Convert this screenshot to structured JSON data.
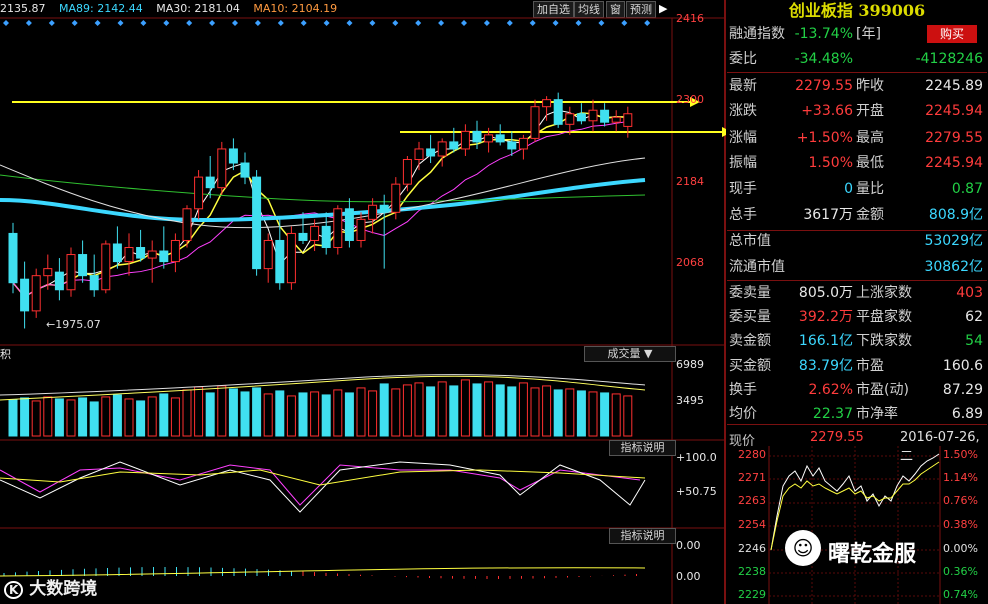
{
  "ma_bar": {
    "first": "2135.87",
    "ma89": "MA89: 2142.44",
    "ma30": "MA30: 2181.04",
    "ma10": "MA10: 2104.19"
  },
  "toolbar": {
    "add_watch": "加自选",
    "avg_line": "均线",
    "window": "窗",
    "forecast": "预测"
  },
  "chart_axes": {
    "main_ticks": [
      "2416",
      "2300",
      "2184",
      "2068"
    ],
    "low_annotation": "1975.07",
    "volume_ticks": [
      "6989",
      "3495"
    ],
    "volume_label": "成交量",
    "indicator_label": "指标说明",
    "indicator1_ticks": [
      "100.0",
      "50.75"
    ],
    "indicator2_ticks": [
      "0.00",
      "0.00"
    ],
    "left_stub": "积"
  },
  "chart_data": {
    "type": "candlestick",
    "title": "创业板指 399006",
    "y_ticks": [
      2416,
      2300,
      2184,
      2068
    ],
    "ylim": [
      1960,
      2420
    ],
    "low_marker": 1975.07,
    "horizontal_lines": [
      2300,
      2260
    ],
    "candles": [
      {
        "o": 2110,
        "h": 2125,
        "l": 2025,
        "c": 2040
      },
      {
        "o": 2045,
        "h": 2070,
        "l": 1975,
        "c": 2000
      },
      {
        "o": 2000,
        "h": 2060,
        "l": 1990,
        "c": 2050
      },
      {
        "o": 2050,
        "h": 2080,
        "l": 2030,
        "c": 2060
      },
      {
        "o": 2055,
        "h": 2075,
        "l": 2015,
        "c": 2030
      },
      {
        "o": 2030,
        "h": 2090,
        "l": 2020,
        "c": 2080
      },
      {
        "o": 2080,
        "h": 2100,
        "l": 2040,
        "c": 2050
      },
      {
        "o": 2050,
        "h": 2080,
        "l": 2020,
        "c": 2030
      },
      {
        "o": 2030,
        "h": 2100,
        "l": 2025,
        "c": 2095
      },
      {
        "o": 2095,
        "h": 2120,
        "l": 2060,
        "c": 2070
      },
      {
        "o": 2070,
        "h": 2110,
        "l": 2050,
        "c": 2090
      },
      {
        "o": 2090,
        "h": 2115,
        "l": 2070,
        "c": 2075
      },
      {
        "o": 2075,
        "h": 2100,
        "l": 2040,
        "c": 2085
      },
      {
        "o": 2085,
        "h": 2120,
        "l": 2060,
        "c": 2070
      },
      {
        "o": 2070,
        "h": 2110,
        "l": 2055,
        "c": 2100
      },
      {
        "o": 2100,
        "h": 2150,
        "l": 2090,
        "c": 2145
      },
      {
        "o": 2145,
        "h": 2200,
        "l": 2130,
        "c": 2190
      },
      {
        "o": 2190,
        "h": 2220,
        "l": 2160,
        "c": 2175
      },
      {
        "o": 2175,
        "h": 2240,
        "l": 2165,
        "c": 2230
      },
      {
        "o": 2230,
        "h": 2245,
        "l": 2200,
        "c": 2210
      },
      {
        "o": 2210,
        "h": 2225,
        "l": 2180,
        "c": 2190
      },
      {
        "o": 2190,
        "h": 2200,
        "l": 2050,
        "c": 2060
      },
      {
        "o": 2060,
        "h": 2110,
        "l": 2040,
        "c": 2100
      },
      {
        "o": 2100,
        "h": 2130,
        "l": 2030,
        "c": 2040
      },
      {
        "o": 2040,
        "h": 2120,
        "l": 2030,
        "c": 2110
      },
      {
        "o": 2110,
        "h": 2140,
        "l": 2095,
        "c": 2100
      },
      {
        "o": 2100,
        "h": 2130,
        "l": 2085,
        "c": 2120
      },
      {
        "o": 2120,
        "h": 2140,
        "l": 2080,
        "c": 2090
      },
      {
        "o": 2090,
        "h": 2150,
        "l": 2080,
        "c": 2145
      },
      {
        "o": 2145,
        "h": 2160,
        "l": 2090,
        "c": 2100
      },
      {
        "o": 2100,
        "h": 2140,
        "l": 2090,
        "c": 2130
      },
      {
        "o": 2130,
        "h": 2160,
        "l": 2110,
        "c": 2150
      },
      {
        "o": 2150,
        "h": 2165,
        "l": 2060,
        "c": 2140
      },
      {
        "o": 2140,
        "h": 2190,
        "l": 2130,
        "c": 2180
      },
      {
        "o": 2180,
        "h": 2220,
        "l": 2170,
        "c": 2215
      },
      {
        "o": 2215,
        "h": 2240,
        "l": 2200,
        "c": 2230
      },
      {
        "o": 2230,
        "h": 2250,
        "l": 2210,
        "c": 2220
      },
      {
        "o": 2220,
        "h": 2245,
        "l": 2205,
        "c": 2240
      },
      {
        "o": 2240,
        "h": 2260,
        "l": 2225,
        "c": 2230
      },
      {
        "o": 2230,
        "h": 2265,
        "l": 2220,
        "c": 2255
      },
      {
        "o": 2255,
        "h": 2270,
        "l": 2230,
        "c": 2240
      },
      {
        "o": 2240,
        "h": 2260,
        "l": 2225,
        "c": 2250
      },
      {
        "o": 2250,
        "h": 2265,
        "l": 2235,
        "c": 2240
      },
      {
        "o": 2240,
        "h": 2255,
        "l": 2220,
        "c": 2230
      },
      {
        "o": 2230,
        "h": 2250,
        "l": 2215,
        "c": 2245
      },
      {
        "o": 2245,
        "h": 2300,
        "l": 2240,
        "c": 2290
      },
      {
        "o": 2290,
        "h": 2305,
        "l": 2270,
        "c": 2300
      },
      {
        "o": 2300,
        "h": 2310,
        "l": 2260,
        "c": 2265
      },
      {
        "o": 2265,
        "h": 2290,
        "l": 2250,
        "c": 2280
      },
      {
        "o": 2280,
        "h": 2295,
        "l": 2265,
        "c": 2270
      },
      {
        "o": 2270,
        "h": 2300,
        "l": 2255,
        "c": 2285
      },
      {
        "o": 2285,
        "h": 2295,
        "l": 2262,
        "c": 2268
      },
      {
        "o": 2268,
        "h": 2285,
        "l": 2255,
        "c": 2275
      },
      {
        "o": 2262,
        "h": 2290,
        "l": 2246,
        "c": 2280
      }
    ],
    "volume": [
      3600,
      3800,
      3500,
      3900,
      3700,
      3600,
      3800,
      3400,
      3900,
      4100,
      3700,
      3500,
      3900,
      4200,
      3800,
      4600,
      4900,
      4300,
      5000,
      4700,
      4400,
      4800,
      4200,
      4500,
      4000,
      4300,
      4400,
      4100,
      4600,
      4300,
      4800,
      4500,
      5200,
      4700,
      5100,
      5300,
      4900,
      5400,
      5000,
      5600,
      5200,
      5400,
      5100,
      4900,
      5300,
      4800,
      5000,
      4600,
      4700,
      4500,
      4400,
      4300,
      4200,
      4000
    ],
    "volume_ticks": [
      6989,
      3495
    ],
    "indicator1_ticks": [
      100.0,
      50.75
    ],
    "indicator2_ticks": [
      0.0,
      0.0
    ]
  },
  "quote": {
    "title": "创业板指 399006",
    "buy_label": "购买",
    "rows": [
      {
        "l1": "融通指数",
        "v1": "-13.74%",
        "v1c": "grn",
        "l2": "[年]",
        "v2": "",
        "v2c": "wht"
      },
      {
        "l1": "委比",
        "v1": "-34.48%",
        "v1c": "grn",
        "l2": "",
        "v2": "-4128246",
        "v2c": "grn"
      },
      {
        "l1": "最新",
        "v1": "2279.55",
        "v1c": "red",
        "l2": "昨收",
        "v2": "2245.89",
        "v2c": "wht"
      },
      {
        "l1": "涨跌",
        "v1": "+33.66",
        "v1c": "red",
        "l2": "开盘",
        "v2": "2245.94",
        "v2c": "red"
      },
      {
        "l1": "涨幅",
        "v1": "+1.50%",
        "v1c": "red",
        "l2": "最高",
        "v2": "2279.55",
        "v2c": "red"
      },
      {
        "l1": "振幅",
        "v1": "1.50%",
        "v1c": "red",
        "l2": "最低",
        "v2": "2245.94",
        "v2c": "red"
      },
      {
        "l1": "现手",
        "v1": "0",
        "v1c": "cyan",
        "l2": "量比",
        "v2": "0.87",
        "v2c": "grn"
      },
      {
        "l1": "总手",
        "v1": "3617万",
        "v1c": "wht",
        "l2": "金额",
        "v2": "808.9亿",
        "v2c": "cyan"
      },
      {
        "l1": "总市值",
        "v1": "",
        "v1c": "wht",
        "l2": "",
        "v2": "53029亿",
        "v2c": "cyan"
      },
      {
        "l1": "流通市值",
        "v1": "",
        "v1c": "wht",
        "l2": "",
        "v2": "30862亿",
        "v2c": "cyan"
      },
      {
        "l1": "委卖量",
        "v1": "805.0万",
        "v1c": "wht",
        "l2": "上涨家数",
        "v2": "403",
        "v2c": "red"
      },
      {
        "l1": "委买量",
        "v1": "392.2万",
        "v1c": "red",
        "l2": "平盘家数",
        "v2": "62",
        "v2c": "wht"
      },
      {
        "l1": "卖金额",
        "v1": "166.1亿",
        "v1c": "cyan",
        "l2": "下跌家数",
        "v2": "54",
        "v2c": "grn"
      },
      {
        "l1": "买金额",
        "v1": "83.79亿",
        "v1c": "cyan",
        "l2": "市盈",
        "v2": "160.6",
        "v2c": "wht"
      },
      {
        "l1": "换手",
        "v1": "2.62%",
        "v1c": "red",
        "l2": "市盈(动)",
        "v2": "87.29",
        "v2c": "wht"
      },
      {
        "l1": "均价",
        "v1": "22.37",
        "v1c": "grn",
        "l2": "市净率",
        "v2": "6.89",
        "v2c": "wht"
      }
    ]
  },
  "intraday": {
    "label": "现价",
    "price": "2279.55",
    "date": "2016-07-26,二",
    "left_ticks": [
      "2280",
      "2271",
      "2263",
      "2254",
      "2246",
      "2238",
      "2229"
    ],
    "right_ticks": [
      "1.50%",
      "1.14%",
      "0.76%",
      "0.38%",
      "0.00%",
      "0.36%",
      "0.74%"
    ]
  },
  "watermarks": {
    "left": "大数跨境",
    "right": "曙乾金服"
  }
}
